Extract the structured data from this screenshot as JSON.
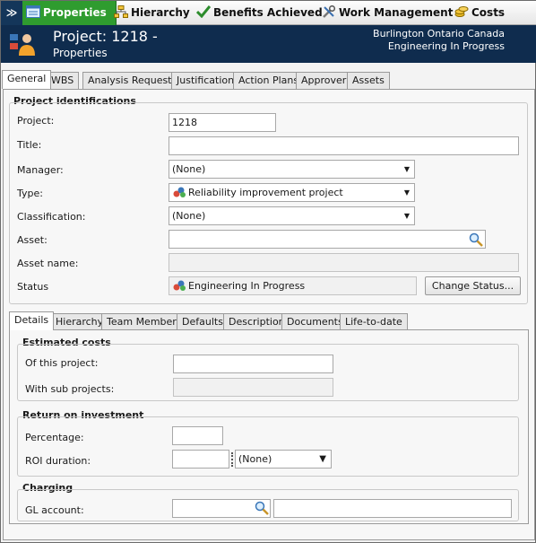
{
  "nav": {
    "tabs": [
      {
        "label": "Properties",
        "icon": "properties-icon"
      },
      {
        "label": "Hierarchy",
        "icon": "hierarchy-icon"
      },
      {
        "label": "Benefits Achieved",
        "icon": "checkmark-icon"
      },
      {
        "label": "Work Management",
        "icon": "tools-icon"
      },
      {
        "label": "Costs",
        "icon": "coins-icon"
      }
    ],
    "menu_glyph": "≫"
  },
  "header": {
    "title": "Project: 1218 -",
    "subtitle": "Properties",
    "location": "Burlington Ontario Canada",
    "status": "Engineering In Progress"
  },
  "main_tabs": [
    "General",
    "WBS",
    "Analysis Requests",
    "Justification",
    "Action Plans",
    "Approver",
    "Assets"
  ],
  "identifications": {
    "title": "Project identifications",
    "project_label": "Project:",
    "project_value": "1218",
    "title_label": "Title:",
    "title_value": "",
    "manager_label": "Manager:",
    "manager_value": "(None)",
    "type_label": "Type:",
    "type_value": "Reliability improvement project",
    "classification_label": "Classification:",
    "classification_value": "(None)",
    "asset_label": "Asset:",
    "asset_value": "",
    "asset_name_label": "Asset name:",
    "asset_name_value": "",
    "status_label": "Status",
    "status_value": "Engineering In Progress",
    "change_status_label": "Change Status..."
  },
  "sub_tabs": [
    "Details",
    "Hierarchy",
    "Team Members",
    "Defaults",
    "Description",
    "Documents",
    "Life-to-date"
  ],
  "estimated_costs": {
    "title": "Estimated costs",
    "this_project_label": "Of this project:",
    "this_project_value": "",
    "sub_projects_label": "With sub projects:",
    "sub_projects_value": ""
  },
  "roi": {
    "title": "Return on investment",
    "percentage_label": "Percentage:",
    "percentage_value": "",
    "duration_label": "ROI duration:",
    "duration_value": "",
    "duration_unit": "(None)"
  },
  "charging": {
    "title": "Charging",
    "gl_label": "GL account:",
    "gl_value": "",
    "gl_desc": ""
  },
  "colors": {
    "nav_active": "#2f9c2f",
    "header_bg": "#0f2c4e"
  }
}
